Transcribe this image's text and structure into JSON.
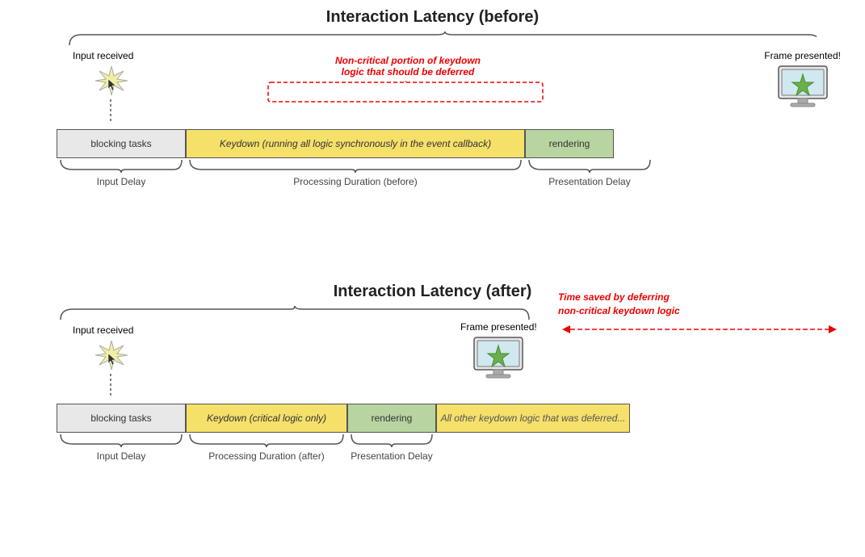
{
  "top_diagram": {
    "title": "Interaction Latency (before)",
    "input_label": "Input received",
    "frame_label": "Frame presented!",
    "blocking_label": "blocking tasks",
    "keydown_label": "Keydown (running all logic synchronously in the event callback)",
    "rendering_label": "rendering",
    "input_delay_label": "Input Delay",
    "processing_label": "Processing Duration (before)",
    "presentation_label": "Presentation Delay",
    "annotation": "Non-critical portion of keydown\nlogic that should be deferred"
  },
  "bottom_diagram": {
    "title": "Interaction Latency (after)",
    "input_label": "Input received",
    "frame_label": "Frame presented!",
    "blocking_label": "blocking tasks",
    "keydown_label": "Keydown (critical logic only)",
    "rendering_label": "rendering",
    "deferred_label": "All other keydown logic that was deferred...",
    "input_delay_label": "Input Delay",
    "processing_label": "Processing Duration (after)",
    "presentation_label": "Presentation Delay",
    "time_saved_label": "Time saved by deferring\nnon-critical keydown logic"
  }
}
